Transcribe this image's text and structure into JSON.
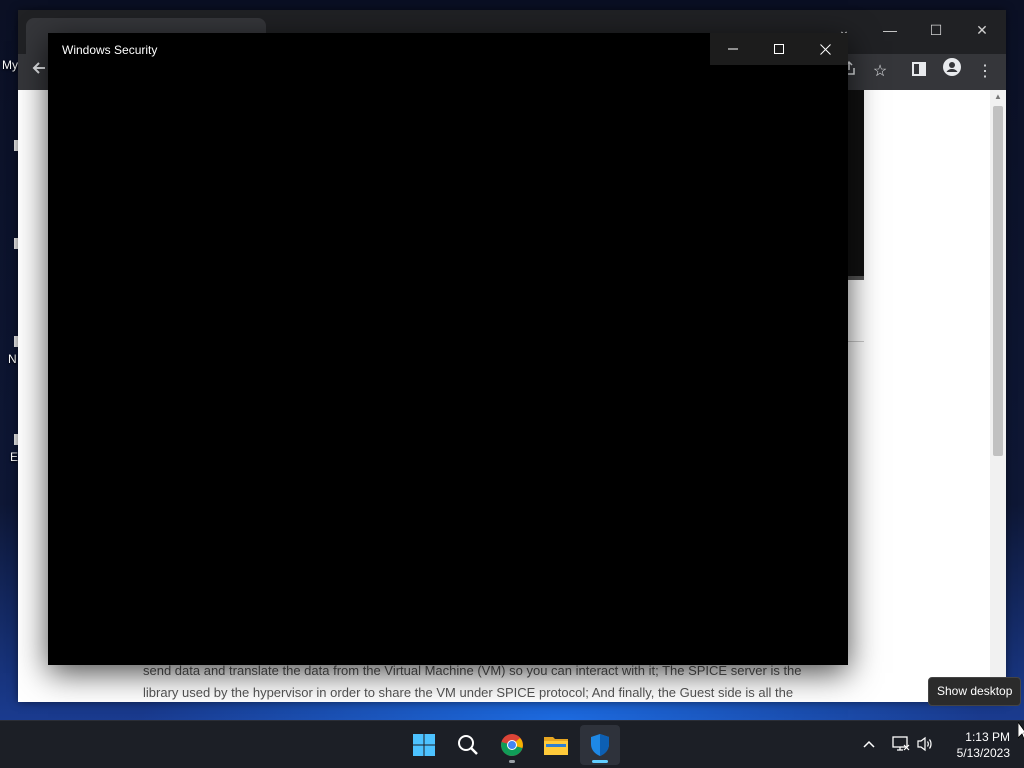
{
  "desktop": {
    "icon_labels": [
      "My",
      "N",
      "E"
    ]
  },
  "browser": {
    "article_lines": [
      "send data and translate the data from the Virtual Machine (VM) so you can interact with it; The SPICE server is the",
      "library used by the hypervisor in order to share the VM under SPICE protocol; And finally, the Guest side is all the"
    ]
  },
  "dialog": {
    "title": "Windows Security",
    "minimize_icon": "minimize-icon",
    "maximize_icon": "maximize-icon",
    "close_icon": "close-icon"
  },
  "taskbar": {
    "apps": [
      {
        "name": "start",
        "icon": "windows-logo-icon"
      },
      {
        "name": "search",
        "icon": "search-icon"
      },
      {
        "name": "chrome",
        "icon": "chrome-icon",
        "running": true
      },
      {
        "name": "file-explorer",
        "icon": "folder-icon"
      },
      {
        "name": "windows-security",
        "icon": "shield-icon",
        "running": true,
        "active": true
      }
    ],
    "tray": {
      "overflow_icon": "chevron-up-icon",
      "network_icon": "network-icon",
      "volume_icon": "volume-icon"
    },
    "time": "1:13 PM",
    "date": "5/13/2023",
    "tooltip": "Show desktop"
  },
  "colors": {
    "accent": "#60cdff",
    "dialog_bg": "#000000",
    "taskbar_bg": "#1c1f26"
  }
}
